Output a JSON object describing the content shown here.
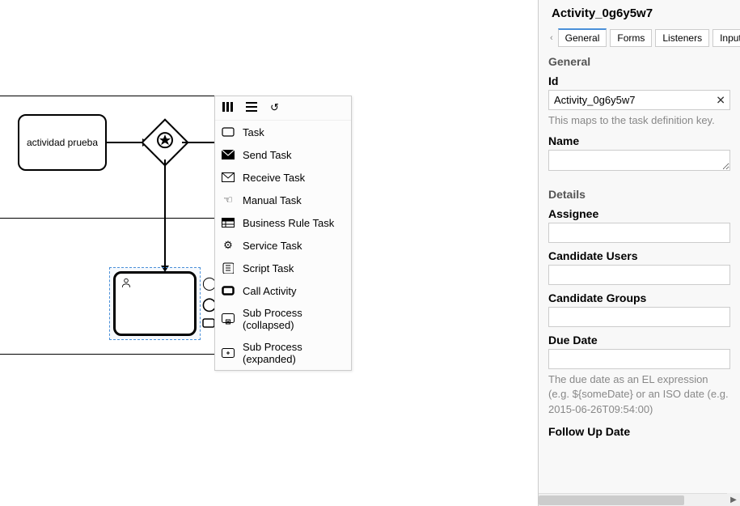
{
  "canvas": {
    "task1_label": "actividad prueba"
  },
  "context_menu": {
    "items": [
      "Task",
      "Send Task",
      "Receive Task",
      "Manual Task",
      "Business Rule Task",
      "Service Task",
      "Script Task",
      "Call Activity",
      "Sub Process (collapsed)",
      "Sub Process (expanded)"
    ]
  },
  "panel": {
    "title": "Activity_0g6y5w7",
    "tabs": [
      "General",
      "Forms",
      "Listeners",
      "Input/O"
    ],
    "section_general": "General",
    "id_label": "Id",
    "id_value": "Activity_0g6y5w7",
    "id_hint": "This maps to the task definition key.",
    "name_label": "Name",
    "name_value": "",
    "section_details": "Details",
    "assignee_label": "Assignee",
    "assignee_value": "",
    "candidate_users_label": "Candidate Users",
    "candidate_users_value": "",
    "candidate_groups_label": "Candidate Groups",
    "candidate_groups_value": "",
    "due_date_label": "Due Date",
    "due_date_value": "",
    "due_date_hint": "The due date as an EL expression (e.g. ${someDate} or an ISO date (e.g. 2015-06-26T09:54:00)",
    "follow_up_label": "Follow Up Date"
  }
}
